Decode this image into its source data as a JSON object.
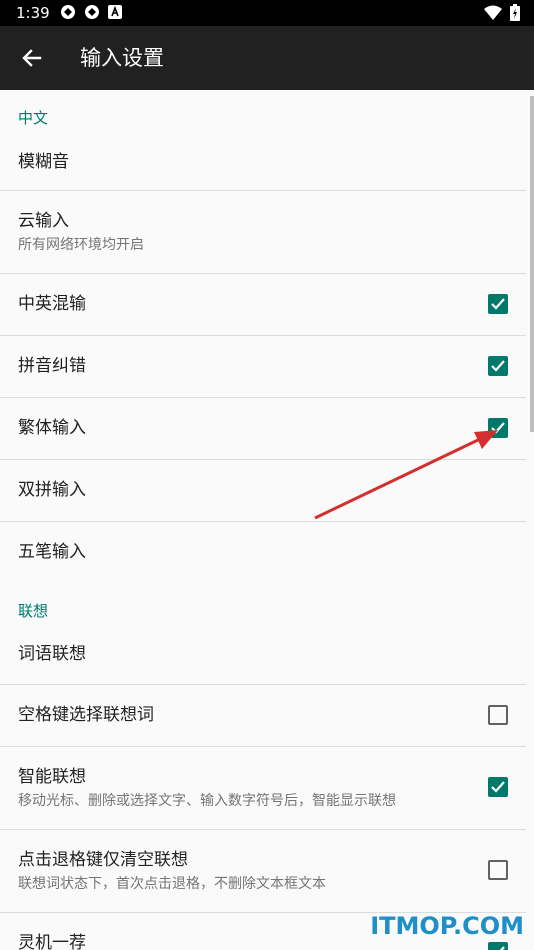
{
  "status_bar": {
    "time": "1:39"
  },
  "toolbar": {
    "title": "输入设置"
  },
  "categories": {
    "chinese": "中文",
    "association": "联想"
  },
  "items": {
    "fuzzy": {
      "title": "模糊音"
    },
    "cloud": {
      "title": "云输入",
      "summary": "所有网络环境均开启"
    },
    "mixed": {
      "title": "中英混输",
      "checked": true
    },
    "pinyin_correct": {
      "title": "拼音纠错",
      "checked": true
    },
    "traditional": {
      "title": "繁体输入",
      "checked": true
    },
    "shuangpin": {
      "title": "双拼输入"
    },
    "wubi": {
      "title": "五笔输入"
    },
    "word_assoc": {
      "title": "词语联想"
    },
    "space_select": {
      "title": "空格键选择联想词",
      "checked": false
    },
    "smart_assoc": {
      "title": "智能联想",
      "summary": "移动光标、删除或选择文字、输入数字符号后，智能显示联想",
      "checked": true
    },
    "backspace_clear": {
      "title": "点击退格键仅清空联想",
      "summary": "联想词状态下，首次点击退格，不删除文本框文本",
      "checked": false
    },
    "lingji": {
      "title": "灵机一荐",
      "checked": true
    }
  },
  "watermark": "ITMOP.COM",
  "colors": {
    "accent": "#00796b",
    "toolbar": "#212121",
    "annotation_arrow": "#d32f2f"
  }
}
